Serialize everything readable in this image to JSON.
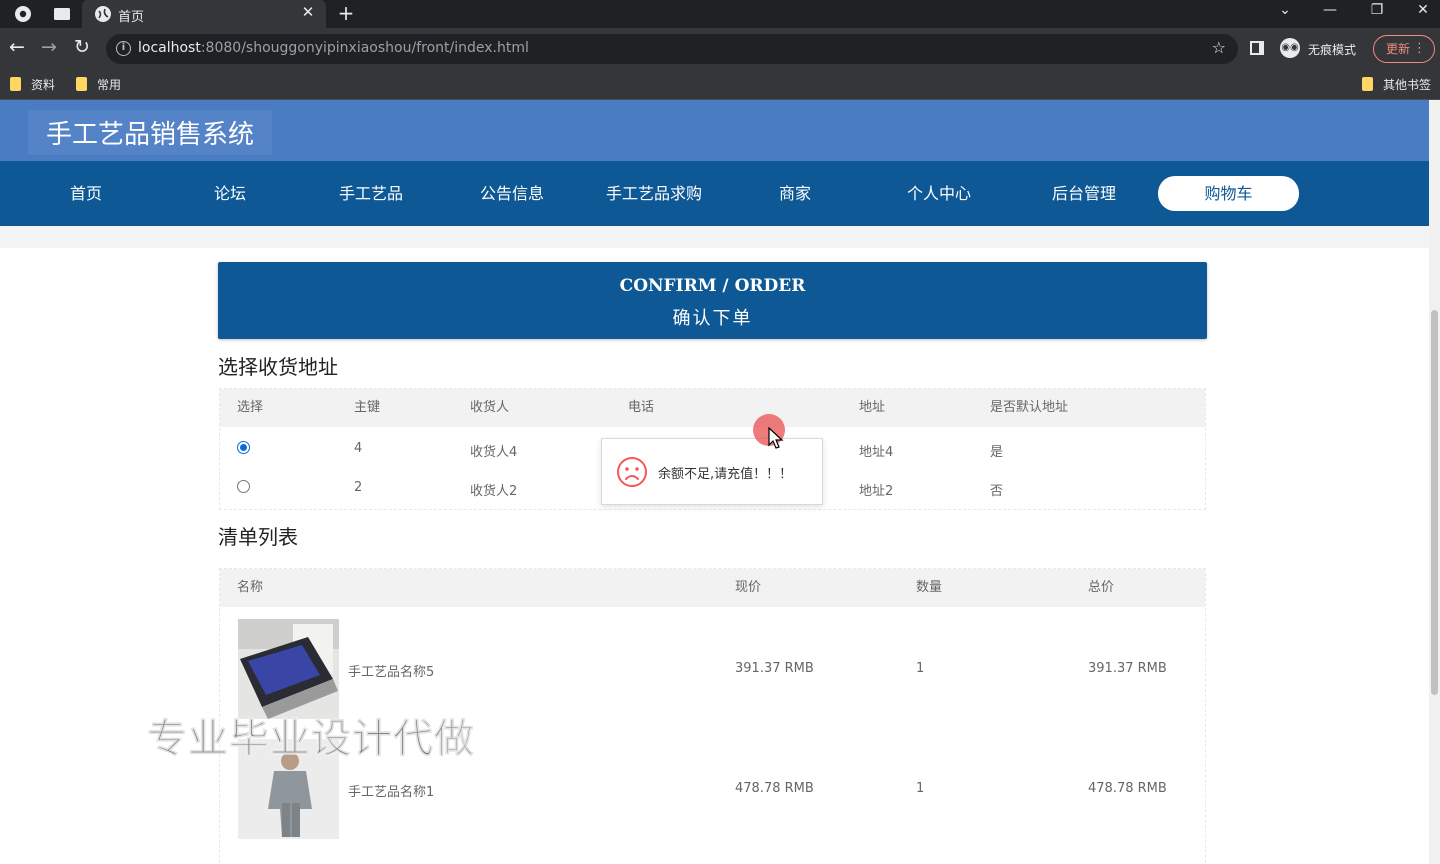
{
  "browser": {
    "tab_title": "首页",
    "url_host": "localhost",
    "url_rest": ":8080/shouggonyipinxiaoshou/front/index.html",
    "incognito_label": "无痕模式",
    "update_label": "更新",
    "bookmarks": [
      "资料",
      "常用"
    ],
    "other_bookmarks": "其他书签"
  },
  "site": {
    "title": "手工艺品销售系统",
    "nav": [
      "首页",
      "论坛",
      "手工艺品",
      "公告信息",
      "手工艺品求购",
      "商家",
      "个人中心",
      "后台管理"
    ],
    "cart_label": "购物车"
  },
  "banner": {
    "en": "CONFIRM / ORDER",
    "cn": "确认下单"
  },
  "address": {
    "section_title": "选择收货地址",
    "headers": [
      "选择",
      "主键",
      "收货人",
      "电话",
      "地址",
      "是否默认地址"
    ],
    "rows": [
      {
        "selected": true,
        "id": "4",
        "name": "收货人4",
        "phone": "",
        "address": "地址4",
        "is_default": "是"
      },
      {
        "selected": false,
        "id": "2",
        "name": "收货人2",
        "phone": "",
        "address": "地址2",
        "is_default": "否"
      }
    ]
  },
  "order_list": {
    "section_title": "清单列表",
    "headers": [
      "名称",
      "现价",
      "数量",
      "总价"
    ],
    "rows": [
      {
        "name": "手工艺品名称5",
        "price": "391.37 RMB",
        "qty": "1",
        "total": "391.37 RMB"
      },
      {
        "name": "手工艺品名称1",
        "price": "478.78 RMB",
        "qty": "1",
        "total": "478.78 RMB"
      }
    ]
  },
  "toast": {
    "message": "余额不足,请充值！！！",
    "icon": "sad-face-icon",
    "color": "#f25a5a"
  },
  "watermark": "专业毕业设计代做",
  "colors": {
    "nav_blue": "#0d5895",
    "header_blue": "#4a7cc4"
  }
}
